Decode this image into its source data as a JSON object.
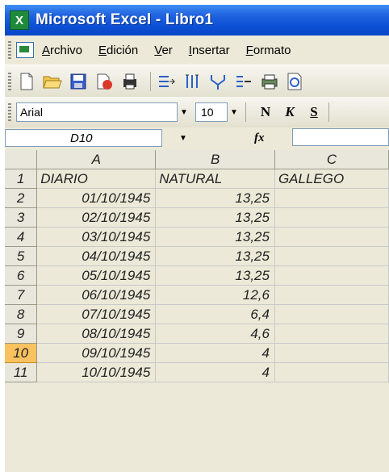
{
  "window": {
    "title": "Microsoft Excel - Libro1",
    "app_icon": "excel-icon"
  },
  "menu": {
    "items": [
      {
        "label": "Archivo",
        "key": "A"
      },
      {
        "label": "Edición",
        "key": "E"
      },
      {
        "label": "Ver",
        "key": "V"
      },
      {
        "label": "Insertar",
        "key": "I"
      },
      {
        "label": "Formato",
        "key": "F"
      }
    ]
  },
  "toolbar": {
    "icons": [
      "new-icon",
      "open-icon",
      "save-icon",
      "permission-icon",
      "print-area-icon",
      "insert-row-icon",
      "insert-column-icon",
      "merge-icon",
      "indent-icon",
      "print-icon",
      "print-preview-icon"
    ]
  },
  "format": {
    "font": "Arial",
    "size": "10",
    "bold": "N",
    "italic": "K",
    "underline": "S"
  },
  "namebar": {
    "name": "D10",
    "fx": "fx",
    "formula": ""
  },
  "sheet": {
    "columns": [
      "A",
      "B",
      "C"
    ],
    "rows": [
      {
        "num": "1",
        "a": "DIARIO",
        "b": "NATURAL",
        "c": "GALLEGO"
      },
      {
        "num": "2",
        "a": "01/10/1945",
        "b": "13,25",
        "c": ""
      },
      {
        "num": "3",
        "a": "02/10/1945",
        "b": "13,25",
        "c": ""
      },
      {
        "num": "4",
        "a": "03/10/1945",
        "b": "13,25",
        "c": ""
      },
      {
        "num": "5",
        "a": "04/10/1945",
        "b": "13,25",
        "c": ""
      },
      {
        "num": "6",
        "a": "05/10/1945",
        "b": "13,25",
        "c": ""
      },
      {
        "num": "7",
        "a": "06/10/1945",
        "b": "12,6",
        "c": ""
      },
      {
        "num": "8",
        "a": "07/10/1945",
        "b": "6,4",
        "c": ""
      },
      {
        "num": "9",
        "a": "08/10/1945",
        "b": "4,6",
        "c": ""
      },
      {
        "num": "10",
        "a": "09/10/1945",
        "b": "4",
        "c": ""
      },
      {
        "num": "11",
        "a": "10/10/1945",
        "b": "4",
        "c": ""
      }
    ],
    "active_row": "10"
  },
  "colors": {
    "titlebar": "#0b4fd6",
    "active_header": "#f9c15f"
  }
}
